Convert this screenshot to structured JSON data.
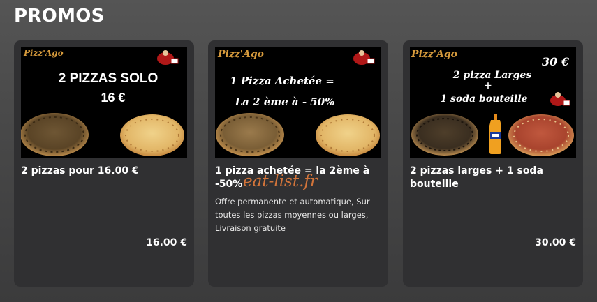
{
  "section_title": "PROMOS",
  "watermark": "eat-list.fr",
  "promos": [
    {
      "image": {
        "brand": "Pizz'Ago",
        "lines": [
          "2 PIZZAS SOLO",
          "16 €"
        ]
      },
      "title": "2 pizzas pour 16.00 €",
      "description": "",
      "price": "16.00 €"
    },
    {
      "image": {
        "brand": "Pizz'Ago",
        "lines": [
          "1 Pizza Achetée =",
          "La 2 ème à - 50%"
        ]
      },
      "title": "1 pizza achetée = la 2ème à -50%",
      "description": "Offre permanente et automatique, Sur toutes les pizzas moyennes ou larges, Livraison gratuite",
      "price": ""
    },
    {
      "image": {
        "brand": "Pizz'Ago",
        "price": "30 €",
        "lines": [
          "2 pizza Larges",
          "+",
          "1 soda bouteille"
        ]
      },
      "title": "2 pizzas larges + 1 soda bouteille",
      "description": "",
      "price": "30.00 €"
    }
  ]
}
